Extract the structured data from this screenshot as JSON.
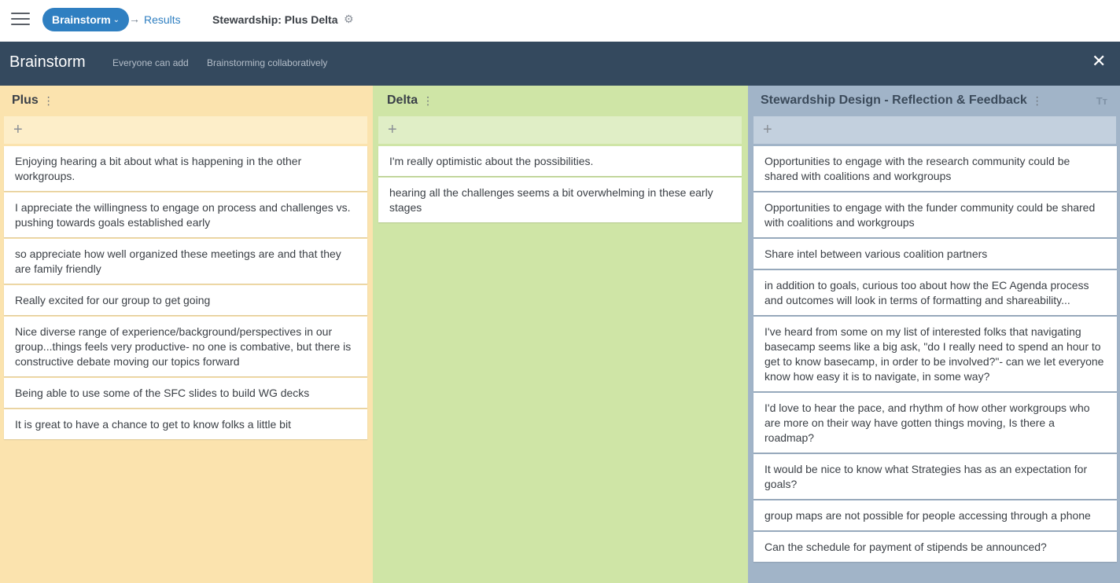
{
  "topbar": {
    "stage_label": "Brainstorm",
    "stage_chevron": "⌄",
    "arrow": "→",
    "results_label": "Results",
    "session_title": "Stewardship: Plus Delta",
    "gear": "⚙"
  },
  "header": {
    "title": "Brainstorm",
    "sub1": "Everyone can add",
    "sub2": "Brainstorming collaboratively",
    "close": "✕"
  },
  "columns": {
    "plus": {
      "title": "Plus",
      "kebab": "⋮",
      "add": "+",
      "cards": [
        "Enjoying hearing a bit about what is happening in the other workgroups.",
        "I appreciate the willingness to engage on process and challenges vs. pushing towards goals established early",
        "so appreciate how well organized these meetings are and that they are family friendly",
        "Really excited for our group to get going",
        "Nice diverse range of experience/background/perspectives in our group...things feels very productive- no one is combative, but there is constructive debate moving our topics forward",
        "Being able to use some of the SFC slides to build WG decks",
        "It is great to have a chance to get to know folks a little bit"
      ]
    },
    "delta": {
      "title": "Delta",
      "kebab": "⋮",
      "add": "+",
      "cards": [
        "I'm really optimistic about the possibilities.",
        "hearing all the challenges seems a bit overwhelming in these early stages"
      ]
    },
    "stew": {
      "title": "Stewardship Design - Reflection & Feedback",
      "kebab": "⋮",
      "tt": "Tт",
      "add": "+",
      "cards": [
        "Opportunities to engage with the research community could be shared with coalitions and workgroups",
        "Opportunities to engage with the funder community could be shared with coalitions and workgroups",
        "Share intel between various coalition partners",
        "in addition to goals, curious too about how the  EC Agenda process and outcomes will  look in terms of formatting and shareability...",
        "I've heard from some on my list of interested folks that navigating basecamp seems like a big ask, \"do I really need to spend an hour to get to know basecamp, in order to be involved?\"- can we let everyone know how easy it is to navigate, in some way?",
        "I'd love to hear the pace, and rhythm of how other workgroups who are more on their way have gotten things moving, Is there a roadmap?",
        "It would be nice to know what Strategies has as an expectation for goals?",
        "group maps are not possible for people accessing through a phone",
        "Can the schedule for payment of stipends be announced?"
      ]
    }
  }
}
